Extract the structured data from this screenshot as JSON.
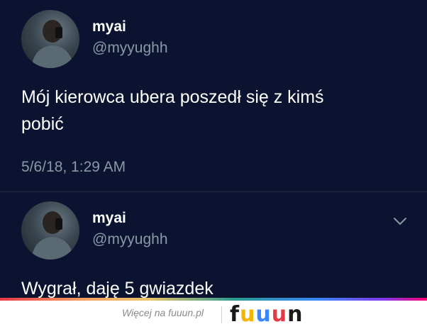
{
  "tweets": [
    {
      "name": "myai",
      "handle": "@myyughh",
      "text": "Mój kierowca ubera poszedł się z kimś\npobić",
      "timestamp": "5/6/18, 1:29 AM"
    },
    {
      "name": "myai",
      "handle": "@myyughh",
      "text": "Wygrał, daję 5 gwiazdek",
      "menu_icon": "chevron-down-icon"
    }
  ],
  "footer": {
    "more_link": "Więcej na fuuun.pl",
    "logo_letters": [
      "f",
      "u",
      "u",
      "u",
      "n"
    ],
    "logo_colors": [
      "#1a1a1a",
      "#f4b400",
      "#3a86ff",
      "#e63946",
      "#1a1a1a"
    ]
  },
  "colors": {
    "background": "#0b1330",
    "secondary_text": "#8899a6",
    "primary_text": "#ffffff"
  }
}
